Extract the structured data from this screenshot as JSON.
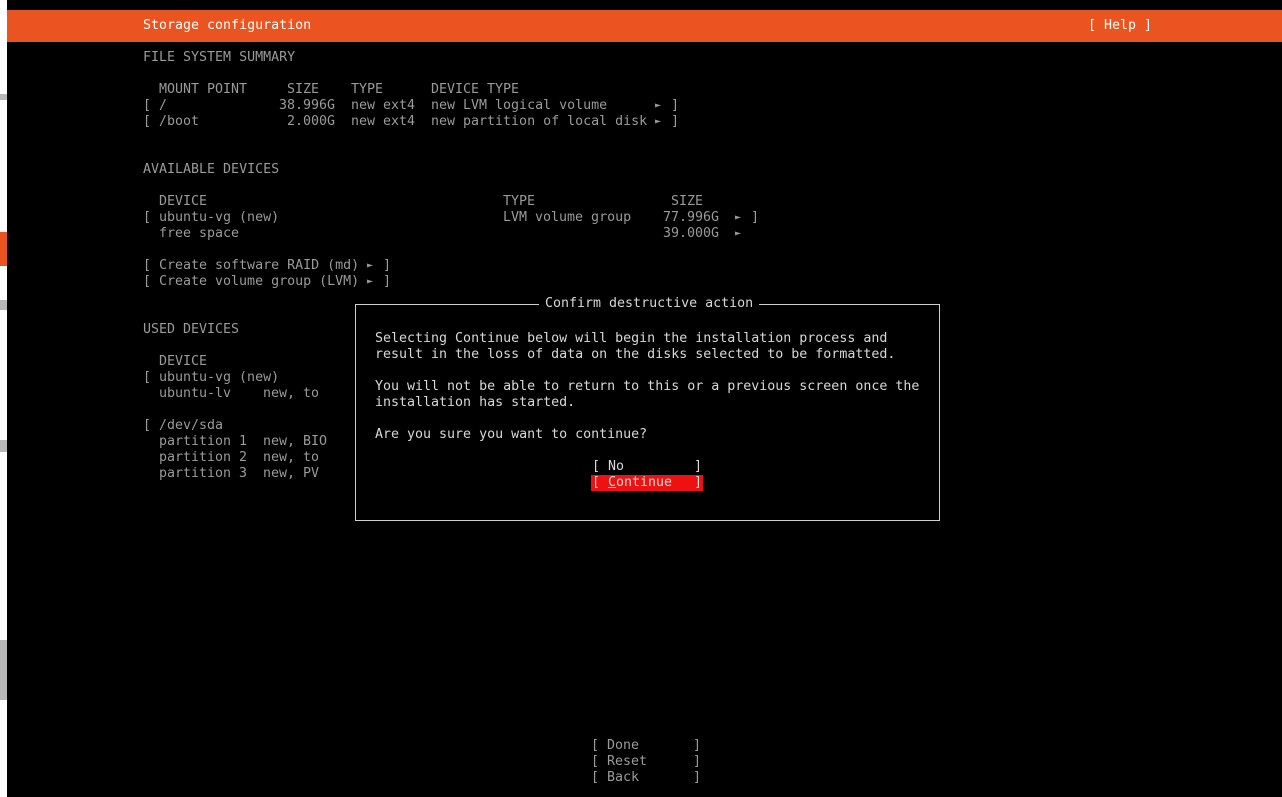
{
  "header": {
    "title": "Storage configuration",
    "help_label": "[ Help ]"
  },
  "fs_summary": {
    "heading": "FILE SYSTEM SUMMARY",
    "columns": [
      "MOUNT POINT",
      "SIZE",
      "TYPE",
      "DEVICE TYPE"
    ],
    "rows": [
      {
        "mount": "/",
        "size": "38.996G",
        "type": "new ext4",
        "device_type": "new LVM logical volume"
      },
      {
        "mount": "/boot",
        "size": "2.000G",
        "type": "new ext4",
        "device_type": "new partition of local disk"
      }
    ]
  },
  "available": {
    "heading": "AVAILABLE DEVICES",
    "columns": [
      "DEVICE",
      "TYPE",
      "SIZE"
    ],
    "rows": [
      {
        "device": "ubuntu-vg (new)",
        "type": "LVM volume group",
        "size": "77.996G"
      },
      {
        "device": "free space",
        "type": "",
        "size": "39.000G"
      }
    ],
    "actions": [
      "Create software RAID (md)",
      "Create volume group (LVM)"
    ]
  },
  "used": {
    "heading": "USED DEVICES",
    "column": "DEVICE",
    "groups": [
      {
        "device": "ubuntu-vg (new)",
        "children": [
          {
            "name": "ubuntu-lv",
            "info": "new, to"
          }
        ]
      },
      {
        "device": "/dev/sda",
        "children": [
          {
            "name": "partition 1",
            "info": "new, BIO"
          },
          {
            "name": "partition 2",
            "info": "new, to"
          },
          {
            "name": "partition 3",
            "info": "new, PV"
          }
        ]
      }
    ]
  },
  "dialog": {
    "title": "Confirm destructive action",
    "para1_line1": "Selecting Continue below will begin the installation process and",
    "para1_line2": "result in the loss of data on the disks selected to be formatted.",
    "para2_line1": "You will not be able to return to this or a previous screen once the",
    "para2_line2": "installation has started.",
    "question": "Are you sure you want to continue?",
    "no_label": "No",
    "continue_first": "C",
    "continue_rest": "ontinue",
    "selected": "Continue"
  },
  "footer": {
    "buttons": [
      "Done",
      "Reset",
      "Back"
    ]
  },
  "glyphs": {
    "open": "[",
    "close": "]",
    "arrow": "►"
  },
  "colors": {
    "header_bg": "#e95420",
    "selected_bg": "#ee1111",
    "text": "#9a9a9a"
  }
}
